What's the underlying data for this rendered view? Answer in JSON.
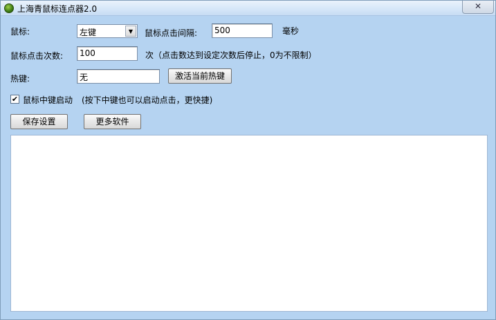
{
  "window": {
    "title": "上海青鼠标连点器2.0",
    "close_icon": "✕"
  },
  "mouse": {
    "label": "鼠标:",
    "selected": "左键",
    "interval_label": "鼠标点击间隔:",
    "interval_value": "500",
    "interval_unit": "毫秒"
  },
  "clicks": {
    "label": "鼠标点击次数:",
    "value": "100",
    "note": "次（点击数达到设定次数后停止，0为不限制）"
  },
  "hotkey": {
    "label": "热键:",
    "value": "无",
    "activate_label": "激活当前热键"
  },
  "middle": {
    "checked": "✔",
    "label": "鼠标中键启动",
    "note": "(按下中键也可以启动点击，更快捷)"
  },
  "actions": {
    "save_label": "保存设置",
    "more_label": "更多软件"
  }
}
